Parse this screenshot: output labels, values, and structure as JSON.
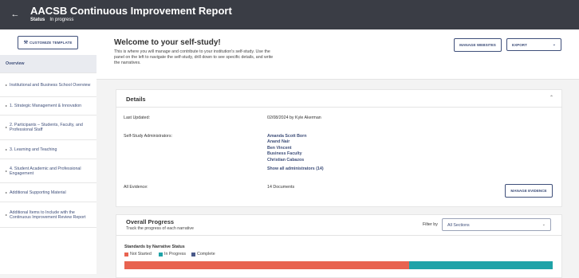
{
  "header": {
    "title": "AACSB Continuous Improvement Report",
    "status_label": "Status",
    "status_value": "In progress"
  },
  "sidebar": {
    "customize_label": "CUSTOMIZE TEMPLATE",
    "items": [
      {
        "label": "Overview",
        "active": true,
        "caret": false
      },
      {
        "label": "Institutional and Business School Overview",
        "caret": true
      },
      {
        "label": "1. Strategic Management & Innovation",
        "caret": true
      },
      {
        "label": "2. Participants – Students, Faculty, and Professional Staff",
        "caret": true
      },
      {
        "label": "3. Learning and Teaching",
        "caret": true
      },
      {
        "label": "4. Student Academic and Professional Engagement",
        "caret": true
      },
      {
        "label": "Additional Supporting Material",
        "caret": true
      },
      {
        "label": "Additional Items to Include with the Continuous Improvement Review Report",
        "caret": true
      }
    ]
  },
  "welcome": {
    "title": "Welcome to your self-study!",
    "description": "This is where you will manage and contribute to your institution's self-study. Use the panel on the left to navigate the self-study, drill down to see specific details, and write the narratives.",
    "manage_websites_label": "MANAGE WEBSITES",
    "export_label": "EXPORT"
  },
  "details": {
    "title": "Details",
    "last_updated_label": "Last Updated:",
    "last_updated_value": "02/08/2024 by Kyle Akerman",
    "admins_label": "Self-Study Administrators:",
    "admins": [
      "Amanda Scott Born",
      "Anand Nair",
      "Ben Vincent",
      "Business Faculty",
      "Christian Cabazos"
    ],
    "show_all_label": "Show all administrators (14)",
    "evidence_label": "All Evidence:",
    "evidence_value": "14 Documents",
    "manage_evidence_label": "MANAGE EVIDENCE"
  },
  "progress": {
    "title": "Overall Progress",
    "subtitle": "Track the progress of each narrative",
    "filter_label": "Filter by",
    "filter_value": "All Sections",
    "standards_title": "Standards by Narrative Status",
    "legend": [
      {
        "label": "Not Started",
        "color": "#e86350"
      },
      {
        "label": "In Progress",
        "color": "#1fa3a8"
      },
      {
        "label": "Complete",
        "color": "#4a5a8a"
      }
    ],
    "status_fractions": {
      "not_started": 0.665,
      "in_progress": 0.335,
      "complete": 0.0
    }
  }
}
